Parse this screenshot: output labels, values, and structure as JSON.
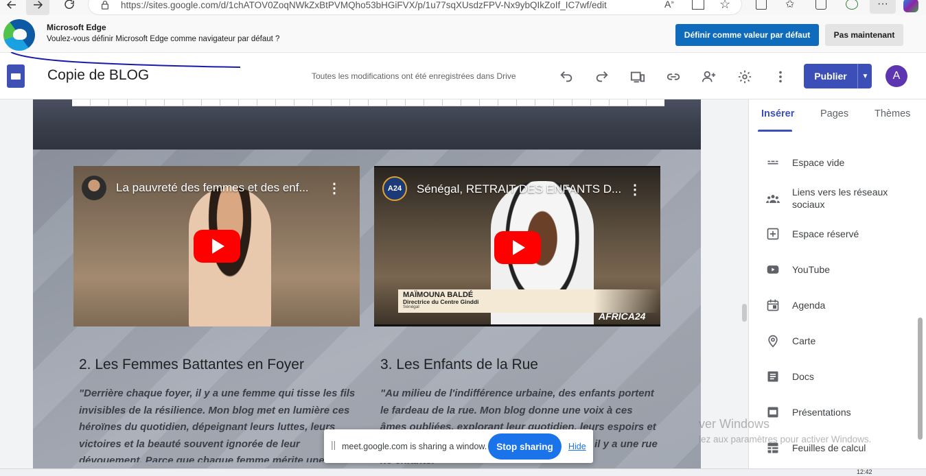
{
  "browser": {
    "url": "https://sites.google.com/d/1chATOV0ZoqNWkZxBtPVMQho53bHGiFVX/p/1u77sqXUsdzFPV-Nx9ybQIkZoIf_IC7wf/edit"
  },
  "infobar": {
    "title": "Microsoft Edge",
    "message": "Voulez-vous définir Microsoft Edge comme navigateur par défaut ?",
    "primary_label": "Définir comme valeur par défaut",
    "secondary_label": "Pas maintenant"
  },
  "sites": {
    "title": "Copie de BLOG",
    "save_status": "Toutes les modifications ont été enregistrées dans Drive",
    "publish_label": "Publier",
    "avatar_letter": "A",
    "accent_color": "#3c4fb9"
  },
  "page": {
    "videos": [
      {
        "title": "La pauvreté des femmes et des enf..."
      },
      {
        "title": "Sénégal, RETRAIT DES ENFANTS D...",
        "lower_third_name": "MAÏMOUNA BALDÉ",
        "lower_third_role": "Directrice du Centre Ginddi",
        "lower_third_place": "Sénégal",
        "watermark": "AFRICA24",
        "channel_label": "A24"
      }
    ],
    "sections": [
      {
        "title": "2. Les Femmes Battantes en Foyer",
        "body": "\"Derrière chaque foyer, il y a une femme qui tisse les fils invisibles de la résilience. Mon blog met en lumière ces héroïnes du quotidien, dépeignant leurs luttes, leurs victoires et la beauté souvent ignorée de leur dévouement. Parce que chaque femme mérite une"
      },
      {
        "title": "3. Les Enfants de la Rue",
        "body": "\"Au milieu de l'indifférence urbaine, des enfants portent le fardeau de la rue. Mon blog donne une voix à ces âmes oubliées, explorant leur quotidien, leurs espoirs et leurs rêves. Au-delà des murs de la misère, il y a une rue ne enfants.\""
      }
    ]
  },
  "panel": {
    "tabs": [
      "Insérer",
      "Pages",
      "Thèmes"
    ],
    "items": [
      {
        "label": "Espace vide",
        "icon": "divider-icon"
      },
      {
        "label": "Liens vers les réseaux sociaux",
        "icon": "people-icon"
      },
      {
        "label": "Espace réservé",
        "icon": "plus-box-icon"
      },
      {
        "label": "YouTube",
        "icon": "youtube-icon"
      },
      {
        "label": "Agenda",
        "icon": "calendar-icon"
      },
      {
        "label": "Carte",
        "icon": "map-pin-icon"
      },
      {
        "label": "Docs",
        "icon": "docs-icon"
      },
      {
        "label": "Présentations",
        "icon": "slides-icon"
      },
      {
        "label": "Feuilles de calcul",
        "icon": "sheets-icon"
      }
    ]
  },
  "windows_watermark": {
    "line1": "ver Windows",
    "line2": "lez aux paramètres pour activer Windows."
  },
  "sharebar": {
    "text": "meet.google.com is sharing a window.",
    "stop_label": "Stop sharing",
    "hide_label": "Hide"
  },
  "taskbar": {
    "clock": "12:42"
  }
}
